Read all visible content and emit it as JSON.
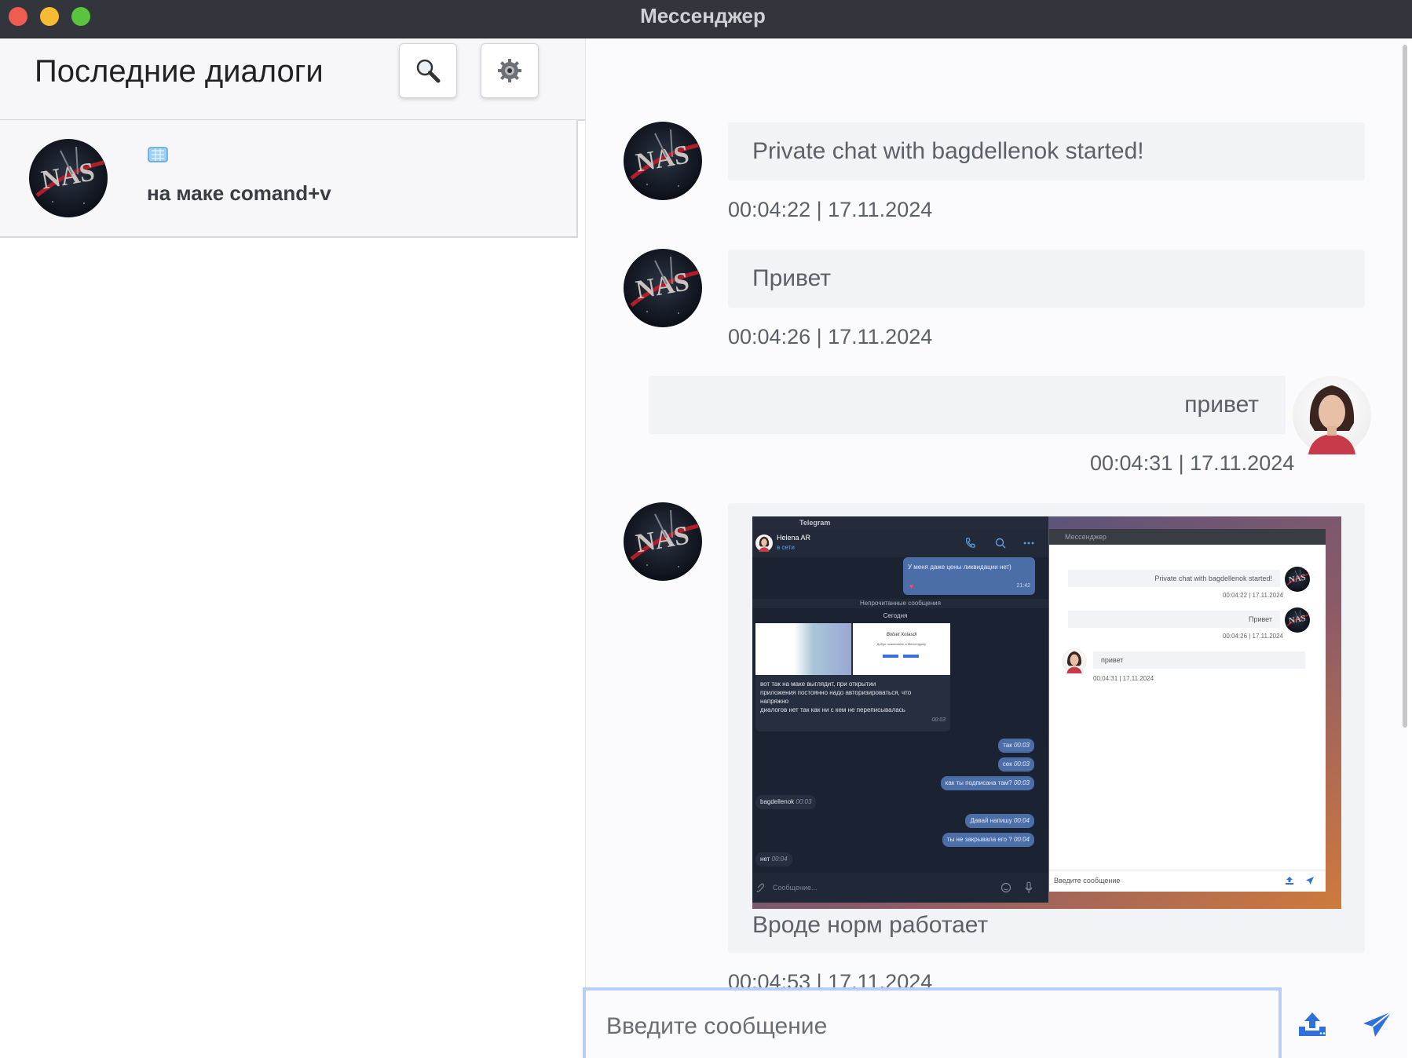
{
  "window": {
    "title": "Мессенджер"
  },
  "sidebar": {
    "title": "Последние диалоги",
    "search_icon": "search-icon",
    "settings_icon": "gear-icon",
    "dialogs": [
      {
        "avatar": "nasa-avatar",
        "name_icon": "ice-cube-emoji",
        "last_message": "на маке comand+v"
      }
    ]
  },
  "chat": {
    "messages": [
      {
        "side": "left",
        "avatar": "nasa-avatar",
        "text": "Private chat with bagdellenok started!",
        "time": "00:04:22 | 17.11.2024"
      },
      {
        "side": "left",
        "avatar": "nasa-avatar",
        "text": "Привет",
        "time": "00:04:26 | 17.11.2024"
      },
      {
        "side": "right",
        "avatar": "woman-avatar",
        "text": "привет",
        "time": "00:04:31 | 17.11.2024"
      },
      {
        "side": "left",
        "avatar": "nasa-avatar",
        "image": "screenshot-attachment",
        "text": "Вроде норм работает",
        "time": "00:04:53 | 17.11.2024"
      }
    ],
    "attachment": {
      "telegram": {
        "window_title": "Telegram",
        "contact_name": "Helena AR",
        "contact_status": "в сети",
        "partial_quote_tail": "У меня даже цены ликвидации нет)",
        "partial_quote_time": "21:42",
        "unread_separator": "Непрочитанные сообщения",
        "today_separator": "Сегодня",
        "long_message_lines": [
          "вот так на маке выглядит, при открытии",
          "приложения постоянно надо авторизироваться, что",
          "напряжно",
          "диалогов нет так как ни с кем не переписывалась"
        ],
        "long_message_time": "00:03",
        "preview_brand": "Bolset Xotasdi",
        "preview_sub": "Добро пожаловать в Мессенджер",
        "out_messages": [
          {
            "text": "так",
            "time": "00:03"
          },
          {
            "text": "сек",
            "time": "00:03"
          },
          {
            "text": "как ты подписана там?",
            "time": "00:03"
          },
          {
            "text": "Давай напишу",
            "time": "00:04"
          },
          {
            "text": "ты не закрывала его ?",
            "time": "00:04"
          }
        ],
        "in_messages": [
          {
            "text": "bagdellenok",
            "time": "00:03"
          },
          {
            "text": "нет",
            "time": "00:04"
          }
        ],
        "input_placeholder": "Сообщение..."
      },
      "messenger": {
        "window_title": "Мессенджер",
        "msg1": "Private chat with bagdellenok started!",
        "msg1_time": "00:04:22 | 17.11.2024",
        "msg2": "Привет",
        "msg2_time": "00:04:26 | 17.11.2024",
        "msg3": "привет",
        "msg3_time": "00:04:31 | 17.11.2024",
        "input_placeholder": "Введите сообщение"
      }
    },
    "input": {
      "placeholder": "Введите сообщение",
      "value": ""
    },
    "upload_icon": "upload-icon",
    "send_icon": "send-icon"
  },
  "colors": {
    "accent": "#2f6fde",
    "titlebar": "#33353d",
    "bubble": "#f2f3f6"
  }
}
